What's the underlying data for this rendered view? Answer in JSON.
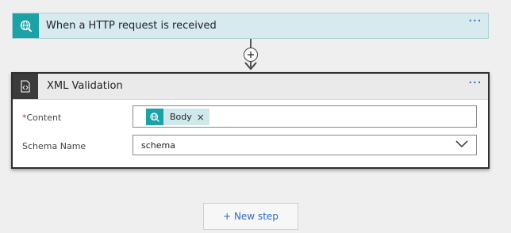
{
  "trigger": {
    "title": "When a HTTP request is received",
    "icon": "globe-request-icon",
    "more_label": "···"
  },
  "connector": {
    "plus_icon": "plus-icon",
    "arrow_icon": "arrow-down-icon"
  },
  "action": {
    "title": "XML Validation",
    "icon": "xml-code-icon",
    "more_label": "···",
    "fields": {
      "content": {
        "required_marker": "*",
        "label": "Content",
        "token": {
          "label": "Body",
          "icon": "globe-request-icon",
          "remove_label": "×"
        }
      },
      "schema": {
        "label": "Schema Name",
        "value": "schema",
        "dropdown_icon": "chevron-down-icon"
      }
    }
  },
  "new_step": {
    "label": "+ New step"
  },
  "colors": {
    "trigger_bg": "#d7ebee",
    "trigger_accent": "#1ba1a6",
    "action_icon_bg": "#3b3b3b",
    "link_blue": "#2b6cc4",
    "required_red": "#c0392b"
  }
}
